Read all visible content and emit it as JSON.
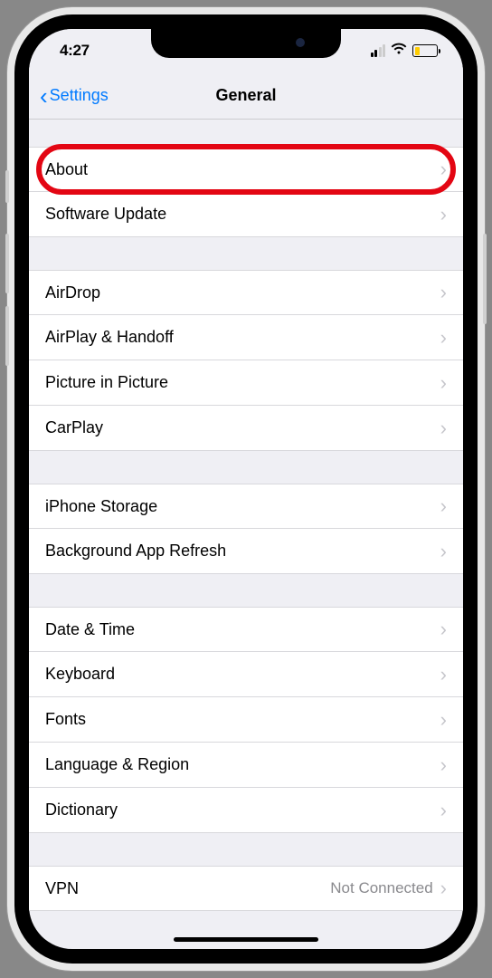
{
  "status": {
    "time": "4:27"
  },
  "nav": {
    "back": "Settings",
    "title": "General"
  },
  "groups": [
    {
      "rows": [
        {
          "label": "About",
          "highlight": true
        },
        {
          "label": "Software Update"
        }
      ]
    },
    {
      "rows": [
        {
          "label": "AirDrop"
        },
        {
          "label": "AirPlay & Handoff"
        },
        {
          "label": "Picture in Picture"
        },
        {
          "label": "CarPlay"
        }
      ]
    },
    {
      "rows": [
        {
          "label": "iPhone Storage"
        },
        {
          "label": "Background App Refresh"
        }
      ]
    },
    {
      "rows": [
        {
          "label": "Date & Time"
        },
        {
          "label": "Keyboard"
        },
        {
          "label": "Fonts"
        },
        {
          "label": "Language & Region"
        },
        {
          "label": "Dictionary"
        }
      ]
    },
    {
      "rows": [
        {
          "label": "VPN",
          "value": "Not Connected"
        }
      ]
    }
  ]
}
